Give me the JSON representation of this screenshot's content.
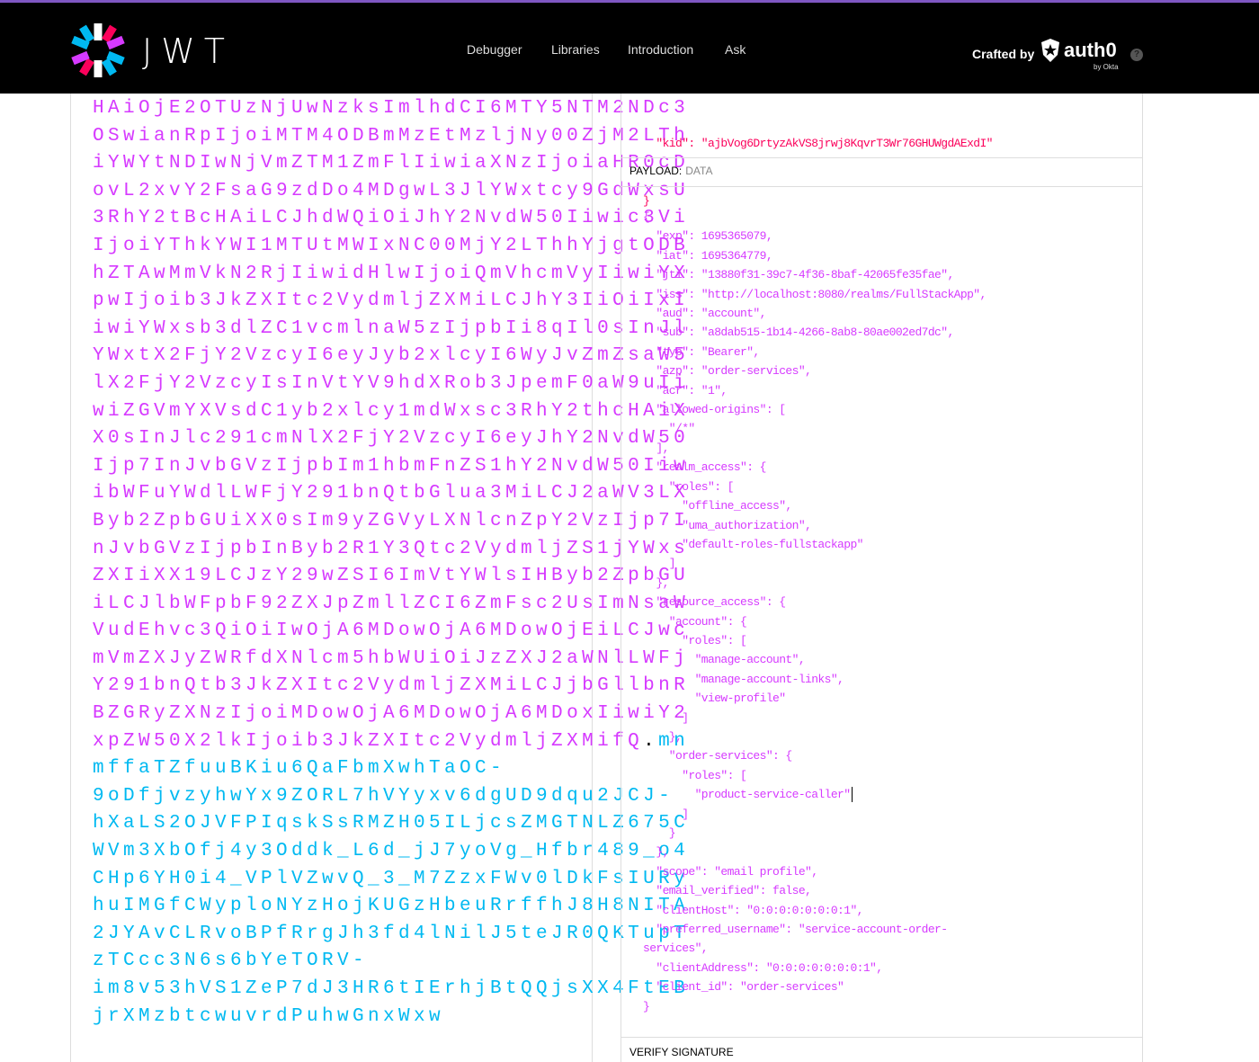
{
  "header": {
    "brand": "JWT",
    "nav": [
      "Debugger",
      "Libraries",
      "Introduction",
      "Ask"
    ],
    "crafted_by": "Crafted by",
    "auth0": "auth0",
    "by_okta": "by Okta",
    "help": "?"
  },
  "colors": {
    "payload": "#d63aff",
    "signature": "#00b9f1",
    "header": "#fb015b",
    "accent": "#7e57c2"
  },
  "encoded": {
    "payload_lines": [
      "HAiOjE2OTUzNjUwNzksImlhdCI6MTY5NTM2NDc3",
      "OSwianRpIjoiMTM4ODBmMzEtMzljNy00ZjM2LTh",
      "iYWYtNDIwNjVmZTM1ZmFlIiwiaXNzIjoiaHR0cD",
      "ovL2xvY2FsaG9zdDo4MDgwL3JlYWxtcy9GdWxsU",
      "3RhY2tBcHAiLCJhdWQiOiJhY2NvdW50Iiwic3Vi",
      "IjoiYThkYWI1MTUtMWIxNC00MjY2LThhYjgtODB",
      "hZTAwMmVkN2RjIiwidHlwIjoiQmVhcmVyIiwiYX",
      "pwIjoib3JkZXItc2VydmljZXMiLCJhY3IiOiIxI",
      "iwiYWxsb3dlZC1vcmlnaW5zIjpbIi8qIl0sInJl",
      "YWxtX2FjY2VzcyI6eyJyb2xlcyI6WyJvZmZsaW5",
      "lX2FjY2VzcyIsInVtYV9hdXRob3JpemF0aW9uIi",
      "wiZGVmYXVsdC1yb2xlcy1mdWxsc3RhY2thcHAiX",
      "X0sInJlc291cmNlX2FjY2VzcyI6eyJhY2NvdW50",
      "Ijp7InJvbGVzIjpbIm1hbmFnZS1hY2NvdW50Iiw",
      "ibWFuYWdlLWFjY291bnQtbGlua3MiLCJ2aWV3LX",
      "Byb2ZpbGUiXX0sIm9yZGVyLXNlcnZpY2VzIjp7I",
      "nJvbGVzIjpbInByb2R1Y3Qtc2VydmljZS1jYWxs",
      "ZXIiXX19LCJzY29wZSI6ImVtYWlsIHByb2ZpbGU",
      "iLCJlbWFpbF92ZXJpZmllZCI6ZmFsc2UsImNsaW",
      "VudEhvc3QiOiIwOjA6MDowOjA6MDowOjEiLCJwc",
      "mVmZXJyZWRfdXNlcm5hbWUiOiJzZXJ2aWNlLWFj",
      "Y291bnQtb3JkZXItc2VydmljZXMiLCJjbGllbnR",
      "BZGRyZXNzIjoiMDowOjA6MDowOjA6MDoxIiwiY2",
      "xpZW50X2lkIjoib3JkZXItc2VydmljZXMifQ"
    ],
    "separator": ".",
    "signature_first": "mn",
    "signature_lines": [
      "mffaTZfuuBKiu6QaFbmXwhTaOC-",
      "9oDfjvzyhwYx9ZORL7hVYyxv6dgUD9dqu2JCJ-",
      "hXaLS2OJVFPIqskSsRMZH05ILjcsZMGTNLZ675C",
      "WVm3XbOfj4y3Oddk_L6d_jJ7yoVg_Hfbr489_o4",
      "CHp6YH0i4_VPlVZwvQ_3_M7ZzxFWv0lDkFsIURy",
      "huIMGfCWyploNYzHojKUGzHbeuRrffhJ8H8NITA",
      "2JYAvCLRvoBPfRrgJh3fd4lNilJ5teJR0QKTupT",
      "zTCcc3N6s6bYeTORV-",
      "im8v53hVS1ZeP7dJ3HR6tIErhjBtQQjsXX4FtEB",
      "jrXMzbtcwuvrdPuhwGnxWxw"
    ]
  },
  "decoded": {
    "header_lines": [
      "  \"kid\": \"ajbVog6DrtyzAkVS8jrwj8KqvrT3Wr76GHUWgdAExdI\"",
      "}"
    ],
    "payload_label": "PAYLOAD:",
    "payload_sub": "DATA",
    "payload_lines": [
      "{",
      "  \"exp\": 1695365079,",
      "  \"iat\": 1695364779,",
      "  \"jti\": \"13880f31-39c7-4f36-8baf-42065fe35fae\",",
      "  \"iss\": \"http://localhost:8080/realms/FullStackApp\",",
      "  \"aud\": \"account\",",
      "  \"sub\": \"a8dab515-1b14-4266-8ab8-80ae002ed7dc\",",
      "  \"typ\": \"Bearer\",",
      "  \"azp\": \"order-services\",",
      "  \"acr\": \"1\",",
      "  \"allowed-origins\": [",
      "    \"/*\"",
      "  ],",
      "  \"realm_access\": {",
      "    \"roles\": [",
      "      \"offline_access\",",
      "      \"uma_authorization\",",
      "      \"default-roles-fullstackapp\"",
      "    ]",
      "  },",
      "  \"resource_access\": {",
      "    \"account\": {",
      "      \"roles\": [",
      "        \"manage-account\",",
      "        \"manage-account-links\",",
      "        \"view-profile\"",
      "      ]",
      "    },",
      "    \"order-services\": {",
      "      \"roles\": [",
      "        \"product-service-caller\"",
      "      ]",
      "    }",
      "  },",
      "  \"scope\": \"email profile\",",
      "  \"email_verified\": false,",
      "  \"clientHost\": \"0:0:0:0:0:0:0:1\",",
      "  \"preferred_username\": \"service-account-order-",
      "services\",",
      "  \"clientAddress\": \"0:0:0:0:0:0:0:1\",",
      "  \"client_id\": \"order-services\"",
      "}"
    ],
    "verify_label": "VERIFY SIGNATURE"
  }
}
